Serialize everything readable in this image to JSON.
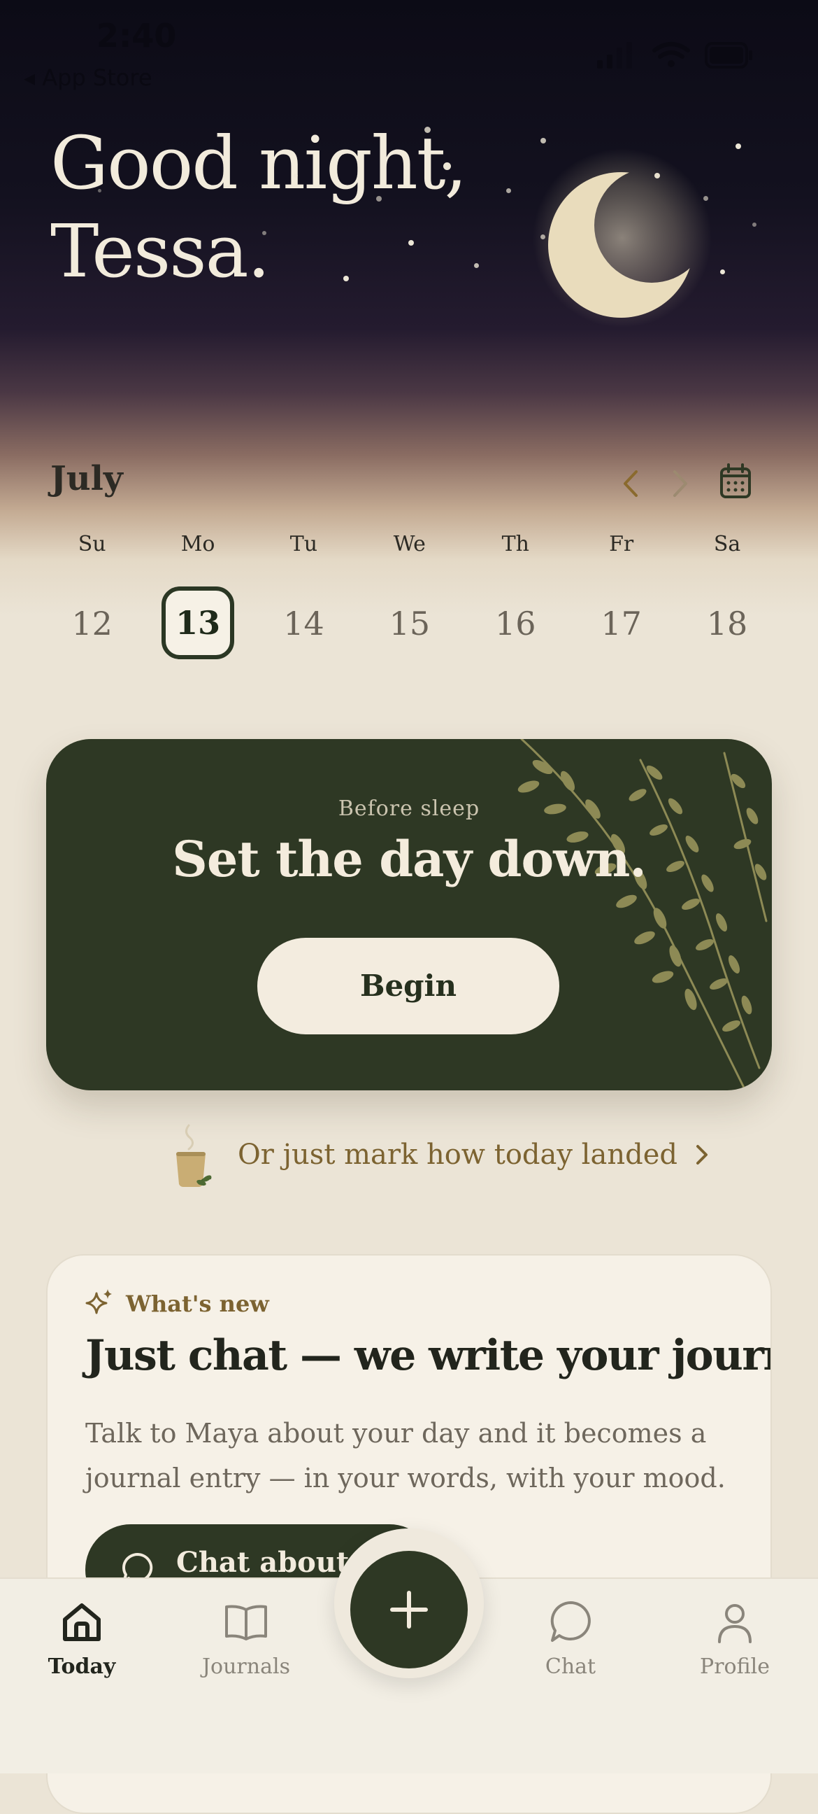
{
  "status_bar": {
    "time": "2:40",
    "back_app": "App Store"
  },
  "greeting": {
    "line1": "Good night,",
    "line2": "Tessa."
  },
  "calendar": {
    "month": "July",
    "weekdays": [
      "Su",
      "Mo",
      "Tu",
      "We",
      "Th",
      "Fr",
      "Sa"
    ],
    "days": [
      "12",
      "13",
      "14",
      "15",
      "16",
      "17",
      "18"
    ],
    "selected_day": "13"
  },
  "sleep_card": {
    "eyebrow": "Before sleep",
    "title": "Set the day down.",
    "button": "Begin"
  },
  "mark_link": {
    "label": "Or just mark how today landed"
  },
  "whats_new": {
    "tag": "What's new",
    "title": "Just chat — we write your journal.",
    "body": "Talk to Maya about your day and it becomes a journal entry — in your words, with your mood.",
    "button": "Chat about today"
  },
  "tabs": [
    {
      "label": "Today",
      "icon": "home-icon",
      "active": true
    },
    {
      "label": "Journals",
      "icon": "book-icon",
      "active": false
    },
    {
      "label": "Chat",
      "icon": "chat-bubble-icon",
      "active": false
    },
    {
      "label": "Profile",
      "icon": "person-icon",
      "active": false
    }
  ],
  "colors": {
    "accent_green": "#2e3824",
    "gold": "#7c6331",
    "cream": "#ebe4d6",
    "night": "#0c0b16"
  }
}
